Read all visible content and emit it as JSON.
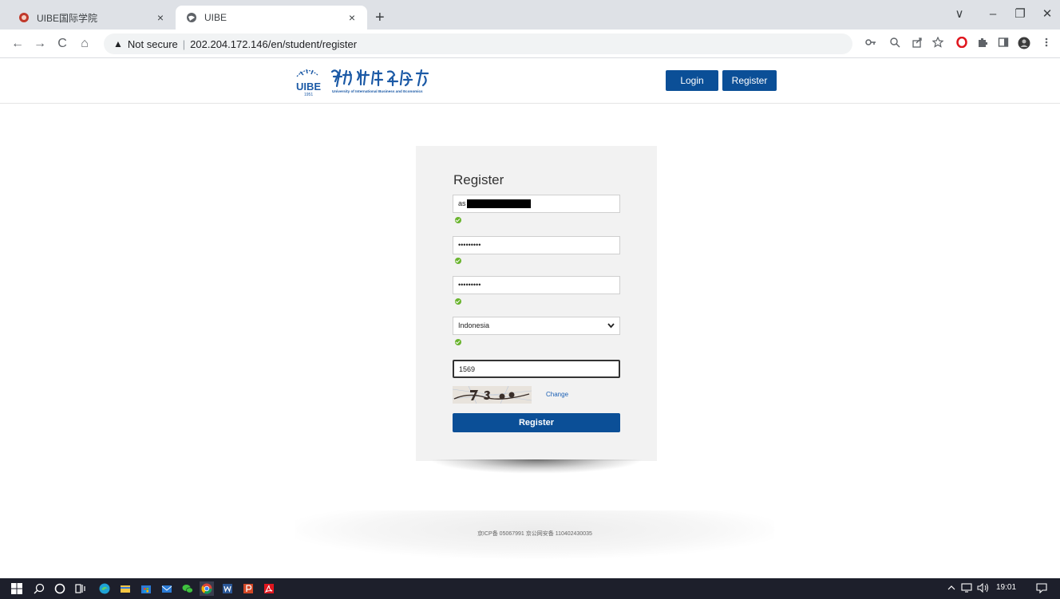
{
  "browser": {
    "tabs": [
      {
        "title": "UIBE国际学院",
        "close": "×"
      },
      {
        "title": "UIBE",
        "close": "×"
      }
    ],
    "new_tab": "+",
    "window_controls": {
      "tab_search": "∨",
      "minimize": "–",
      "restore": "❐",
      "close": "✕"
    },
    "nav": {
      "back": "←",
      "forward": "→",
      "reload": "C",
      "home": "⌂"
    },
    "address": {
      "warning_icon": "▲",
      "security_label": "Not secure",
      "separator": "|",
      "url": "202.204.172.146/en/student/register"
    },
    "toolbar_icons": [
      "key-icon",
      "zoom-icon",
      "share-icon",
      "star-icon",
      "opera-icon",
      "extensions-icon",
      "sidepanel-icon",
      "profile-icon",
      "menu-icon"
    ]
  },
  "header": {
    "login_label": "Login",
    "register_label": "Register",
    "logo_year": "1951",
    "logo_subtitle": "University of International Business and Economics",
    "logo_abbr": "UIBE"
  },
  "form": {
    "title": "Register",
    "username_value": "as",
    "password_value": "•••••••••",
    "confirm_value": "•••••••••",
    "country_value": "Indonesia",
    "captcha_value": "1569",
    "change_label": "Change",
    "submit_label": "Register"
  },
  "footer": {
    "text": "京ICP备 05067991 京公网安备 110402430035"
  },
  "taskbar": {
    "time": "19:01"
  },
  "colors": {
    "primary_button": "#0b4f97",
    "valid_check": "#6ab42e",
    "link": "#1a5fb4"
  }
}
